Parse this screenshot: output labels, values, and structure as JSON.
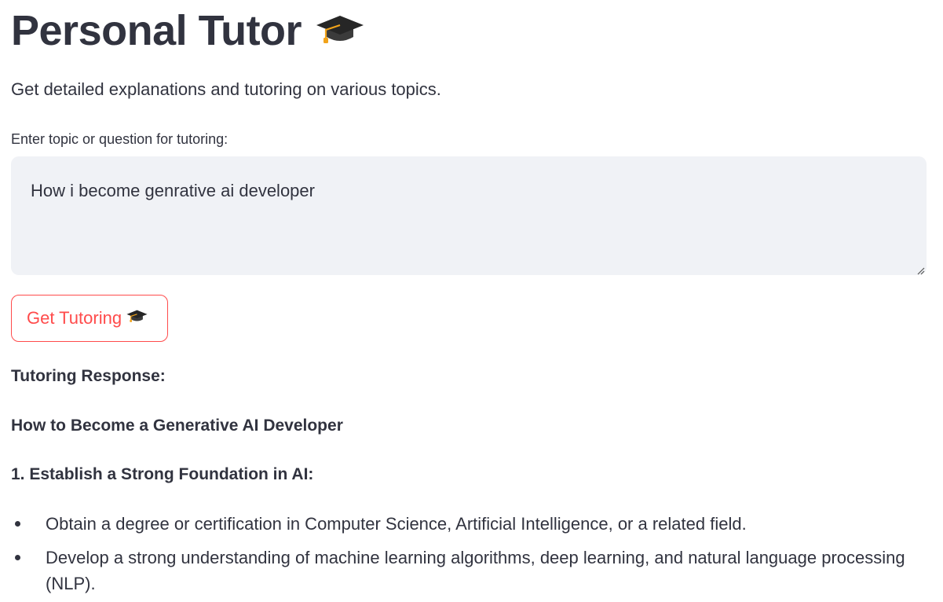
{
  "header": {
    "title": "Personal Tutor",
    "title_icon": "graduation-cap-icon",
    "subtitle": "Get detailed explanations and tutoring on various topics."
  },
  "form": {
    "label": "Enter topic or question for tutoring:",
    "textarea_value": "How i become genrative ai developer",
    "button_label": "Get Tutoring",
    "button_icon": "graduation-cap-icon"
  },
  "response": {
    "heading": "Tutoring Response:",
    "title": "How to Become a Generative AI Developer",
    "section_title": "1. Establish a Strong Foundation in AI:",
    "bullets": [
      "Obtain a degree or certification in Computer Science, Artificial Intelligence, or a related field.",
      "Develop a strong understanding of machine learning algorithms, deep learning, and natural language processing (NLP)."
    ]
  },
  "colors": {
    "text": "#31333f",
    "accent": "#ff4b4b",
    "input_bg": "#f0f2f6",
    "background": "#ffffff"
  }
}
